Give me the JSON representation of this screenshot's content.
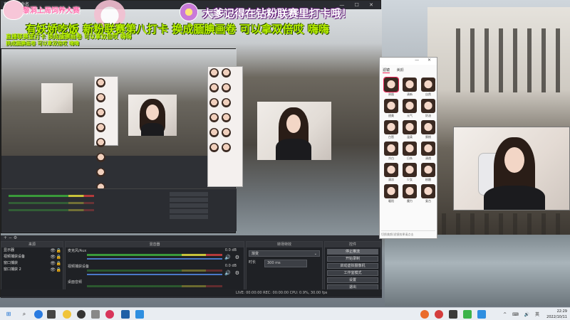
{
  "overlay": {
    "logo_text": "黎洞上周饲养大赛",
    "top_banner": "大爹记得在钻粉联赛里打卡哦！",
    "marquee": "有妖娇吃饭 新粉联赛第八打卡 换成腼腆画卷 可以拿双倍哎 嗨嗨",
    "marquee_small_1": "直播联赛里打卡 换成腼腆画卷 可以拿双倍哎 嗨嗨",
    "marquee_small_2": "换成腼腆画卷 可以拿双倍哎 嗨嗨"
  },
  "obs": {
    "title": "直播 - 未命名",
    "window_controls": "— ☐ ✕",
    "docks": {
      "sources": "来源",
      "mixer": "混音器",
      "transitions": "转场特效",
      "controls": "控件"
    },
    "sources": [
      {
        "label": "显示器"
      },
      {
        "label": "视频捕获设备"
      },
      {
        "label": "窗口捕获"
      },
      {
        "label": "窗口捕获 2"
      }
    ],
    "mixer": [
      {
        "label": "麦克风/Aux",
        "db": "0.0 dB"
      },
      {
        "label": "视频捕获设备",
        "db": "0.0 dB"
      },
      {
        "label": "桌面音频",
        "db": "0.0 dB"
      }
    ],
    "transition": {
      "type": "渐变",
      "duration_label": "时长",
      "duration_value": "300 ms"
    },
    "controls": [
      "停止推流",
      "开始录制",
      "启动虚拟摄像机",
      "工作室模式",
      "设置",
      "退出"
    ],
    "status": "LIVE: 00:00:00   REC: 00:00:00   CPU: 0.9%, 30.00 fps"
  },
  "beauty": {
    "tabs": [
      "滤镜",
      "美颜"
    ],
    "active_tab": "滤镜",
    "filters": [
      "原图",
      "清新",
      "自然",
      "甜美",
      "元气",
      "奶油",
      "白皙",
      "温柔",
      "蜜桃",
      "冷白",
      "日系",
      "清透",
      "清凉",
      "少女",
      "粉嫩",
      "暖阳",
      "魔力",
      "复古"
    ],
    "footer": "切换美颜/滤镜效果请点击"
  },
  "taskbar": {
    "icons": [
      "windows-icon",
      "search-icon",
      "task-view-icon",
      "edge-icon",
      "folder-icon",
      "obs-icon",
      "app-icon",
      "steam-icon",
      "chat-icon",
      "store-icon"
    ],
    "tray": "^ ⌨ 🔊 英",
    "time": "22:29",
    "date": "2022/10/11"
  },
  "colors": {
    "obs_bg": "#26282d",
    "marquee": "#b8f000",
    "banner_outline": "#5a1a70",
    "accent_pink": "#ff6fae"
  }
}
